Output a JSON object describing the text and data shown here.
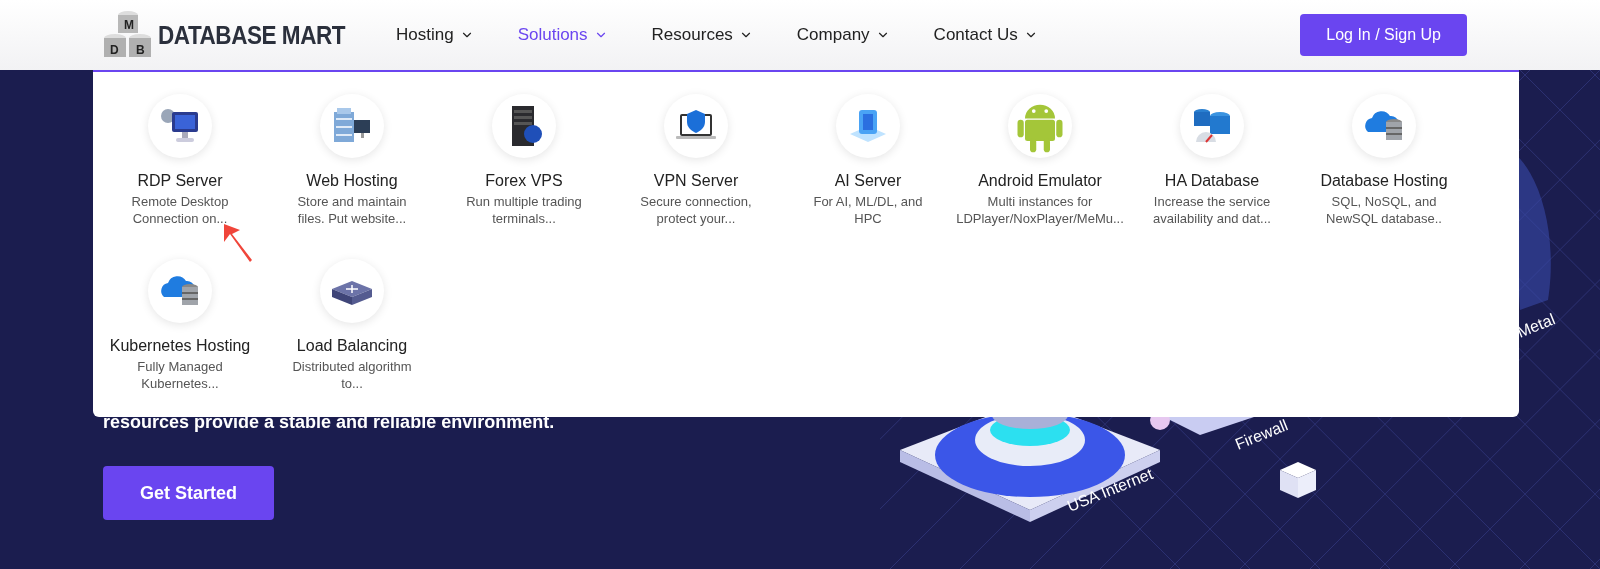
{
  "header": {
    "logo": {
      "letters": [
        "M",
        "D",
        "B"
      ],
      "text": "DATABASE MART"
    },
    "nav": [
      {
        "label": "Hosting",
        "selected": false
      },
      {
        "label": "Solutions",
        "selected": true
      },
      {
        "label": "Resources",
        "selected": false
      },
      {
        "label": "Company",
        "selected": false
      },
      {
        "label": "Contact Us",
        "selected": false
      }
    ],
    "login_button": "Log In / Sign Up"
  },
  "dropdown": {
    "items": [
      {
        "kind": "monitor",
        "title": "RDP Server",
        "description": "Remote Desktop Connection on..."
      },
      {
        "kind": "servers",
        "title": "Web Hosting",
        "description": "Store and maintain files. Put website..."
      },
      {
        "kind": "rack",
        "title": "Forex VPS",
        "description": "Run multiple trading terminals..."
      },
      {
        "kind": "vpn",
        "title": "VPN Server",
        "description": "Secure connection, protect your..."
      },
      {
        "kind": "ai",
        "title": "AI Server",
        "description": "For AI, ML/DL, and HPC"
      },
      {
        "kind": "android",
        "title": "Android Emulator",
        "description": "Multi instances for LDPlayer/NoxPlayer/MeMu..."
      },
      {
        "kind": "gauge",
        "title": "HA Database",
        "description": "Increase the service availability and dat..."
      },
      {
        "kind": "cloud",
        "title": "Database Hosting",
        "description": "SQL, NoSQL, and NewSQL database.."
      },
      {
        "kind": "cloud",
        "title": "Kubernetes Hosting",
        "description": "Fully Managed Kubernetes..."
      },
      {
        "kind": "switch",
        "title": "Load Balancing",
        "description": "Distributed algorithm to..."
      }
    ]
  },
  "hero": {
    "text": "resources provide a stable and reliable environment.",
    "button": "Get Started",
    "illustration_labels": [
      {
        "kind": "internet",
        "text": "USA Internet"
      },
      {
        "kind": "firewall",
        "text": "Firewall"
      },
      {
        "kind": "metal",
        "text": "Metal"
      }
    ]
  }
}
